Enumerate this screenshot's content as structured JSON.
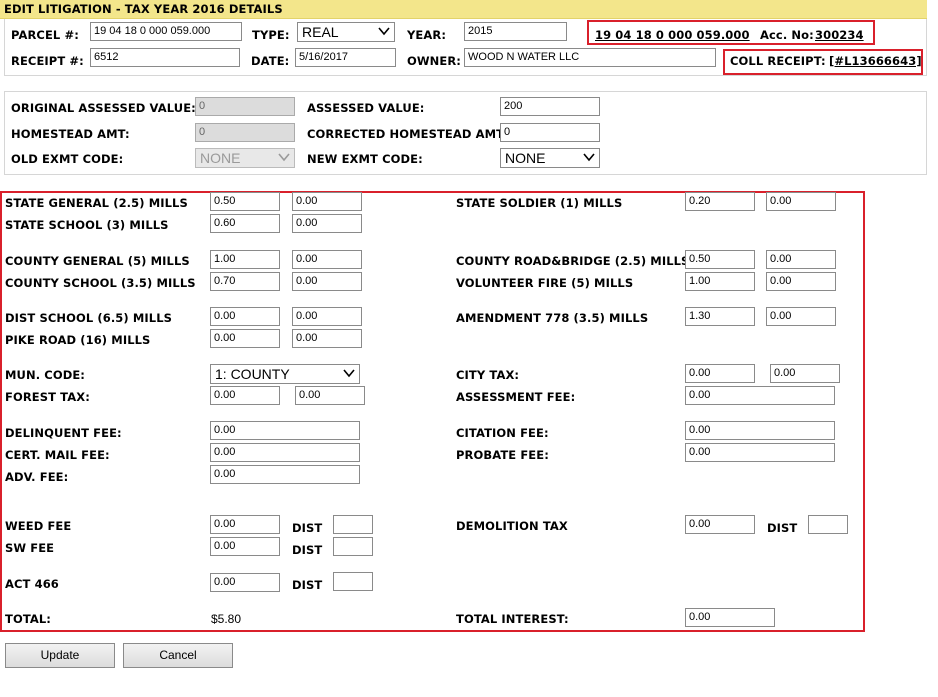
{
  "title": "EDIT LITIGATION - TAX YEAR 2016 DETAILS",
  "header": {
    "parcel_label": "PARCEL #:",
    "parcel_value": "19 04 18 0 000 059.000",
    "type_label": "TYPE:",
    "type_value": "REAL",
    "year_label": "YEAR:",
    "year_value": "2015",
    "parcel_link": "19 04 18 0 000 059.000",
    "acc_label": "Acc. No:",
    "acc_value": "300234",
    "receipt_label": "RECEIPT #:",
    "receipt_value": "6512",
    "date_label": "DATE:",
    "date_value": "5/16/2017",
    "owner_label": "OWNER:",
    "owner_value": "WOOD N WATER LLC",
    "coll_receipt_label": "COLL RECEIPT:",
    "coll_receipt_value": "[#L13666643]"
  },
  "assessment": {
    "orig_assessed_label": "ORIGINAL ASSESSED VALUE:",
    "orig_assessed_value": "0",
    "assessed_label": "ASSESSED VALUE:",
    "assessed_value": "200",
    "homestead_label": "HOMESTEAD AMT:",
    "homestead_value": "0",
    "corrected_homestead_label": "CORRECTED HOMESTEAD AMT:",
    "corrected_homestead_value": "0",
    "old_exmt_label": "OLD EXMT CODE:",
    "old_exmt_value": "NONE",
    "new_exmt_label": "NEW EXMT CODE:",
    "new_exmt_value": "NONE"
  },
  "mills": {
    "state_general": {
      "label": "STATE GENERAL (2.5) MILLS",
      "v1": "0.50",
      "v2": "0.00"
    },
    "state_school": {
      "label": "STATE SCHOOL (3) MILLS",
      "v1": "0.60",
      "v2": "0.00"
    },
    "county_general": {
      "label": "COUNTY GENERAL (5) MILLS",
      "v1": "1.00",
      "v2": "0.00"
    },
    "county_school": {
      "label": "COUNTY SCHOOL (3.5) MILLS",
      "v1": "0.70",
      "v2": "0.00"
    },
    "dist_school": {
      "label": "DIST SCHOOL (6.5) MILLS",
      "v1": "0.00",
      "v2": "0.00"
    },
    "pike_road": {
      "label": "PIKE ROAD (16) MILLS",
      "v1": "0.00",
      "v2": "0.00"
    },
    "state_soldier": {
      "label": "STATE SOLDIER (1) MILLS",
      "v1": "0.20",
      "v2": "0.00"
    },
    "county_road": {
      "label": "COUNTY ROAD&BRIDGE (2.5) MILLS",
      "v1": "0.50",
      "v2": "0.00"
    },
    "volunteer_fire": {
      "label": "VOLUNTEER FIRE (5) MILLS",
      "v1": "1.00",
      "v2": "0.00"
    },
    "amendment_778": {
      "label": "AMENDMENT 778 (3.5) MILLS",
      "v1": "1.30",
      "v2": "0.00"
    }
  },
  "other": {
    "mun_code_label": "MUN. CODE:",
    "mun_code_value": "1: COUNTY",
    "city_tax_label": "CITY TAX:",
    "city_tax_v1": "0.00",
    "city_tax_v2": "0.00",
    "forest_tax_label": "FOREST TAX:",
    "forest_tax_v1": "0.00",
    "forest_tax_v2": "0.00",
    "assessment_fee_label": "ASSESSMENT FEE:",
    "assessment_fee_value": "0.00",
    "delinquent_fee_label": "DELINQUENT FEE:",
    "delinquent_fee_value": "0.00",
    "citation_fee_label": "CITATION FEE:",
    "citation_fee_value": "0.00",
    "cert_mail_fee_label": "CERT. MAIL FEE:",
    "cert_mail_fee_value": "0.00",
    "probate_fee_label": "PROBATE FEE:",
    "probate_fee_value": "0.00",
    "adv_fee_label": "ADV. FEE:",
    "adv_fee_value": "0.00",
    "weed_fee_label": "WEED FEE",
    "weed_fee_value": "0.00",
    "sw_fee_label": "SW FEE",
    "sw_fee_value": "0.00",
    "act_466_label": "ACT 466",
    "act_466_value": "0.00",
    "dist_label": "DIST",
    "demolition_tax_label": "DEMOLITION TAX",
    "demolition_tax_value": "0.00",
    "total_label": "TOTAL:",
    "total_value": "$5.80",
    "total_interest_label": "TOTAL INTEREST:",
    "total_interest_value": "0.00"
  },
  "buttons": {
    "update": "Update",
    "cancel": "Cancel"
  },
  "colors": {
    "title_bg": "#f3e68b",
    "highlight": "#d9202b"
  }
}
